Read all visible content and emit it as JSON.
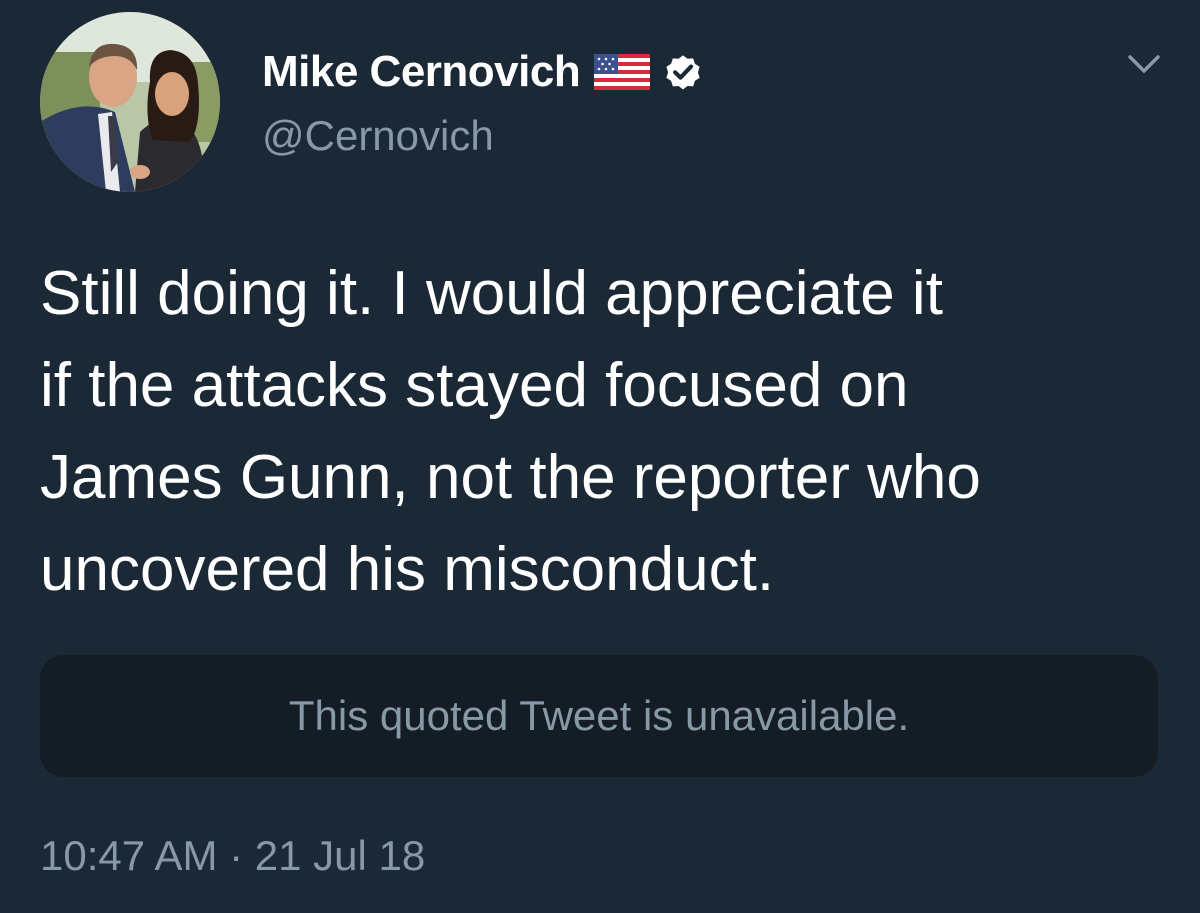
{
  "author": {
    "display_name": "Mike Cernovich",
    "handle": "@Cernovich",
    "flag_icon": "us-flag-icon",
    "verified_icon": "verified-badge-icon"
  },
  "tweet": {
    "text": "Still doing it. I would appreciate it\nif the attacks stayed focused on\nJames Gunn, not the reporter who\nuncovered his misconduct.",
    "quoted_tweet_text": "This quoted Tweet is unavailable.",
    "timestamp": "10:47 AM · 21 Jul 18"
  },
  "icons": {
    "menu": "chevron-down-icon"
  },
  "colors": {
    "background": "#1b2836",
    "secondary_text": "#8899a6",
    "quoted_box": "#141d26",
    "verified_badge": "#ffffff"
  }
}
